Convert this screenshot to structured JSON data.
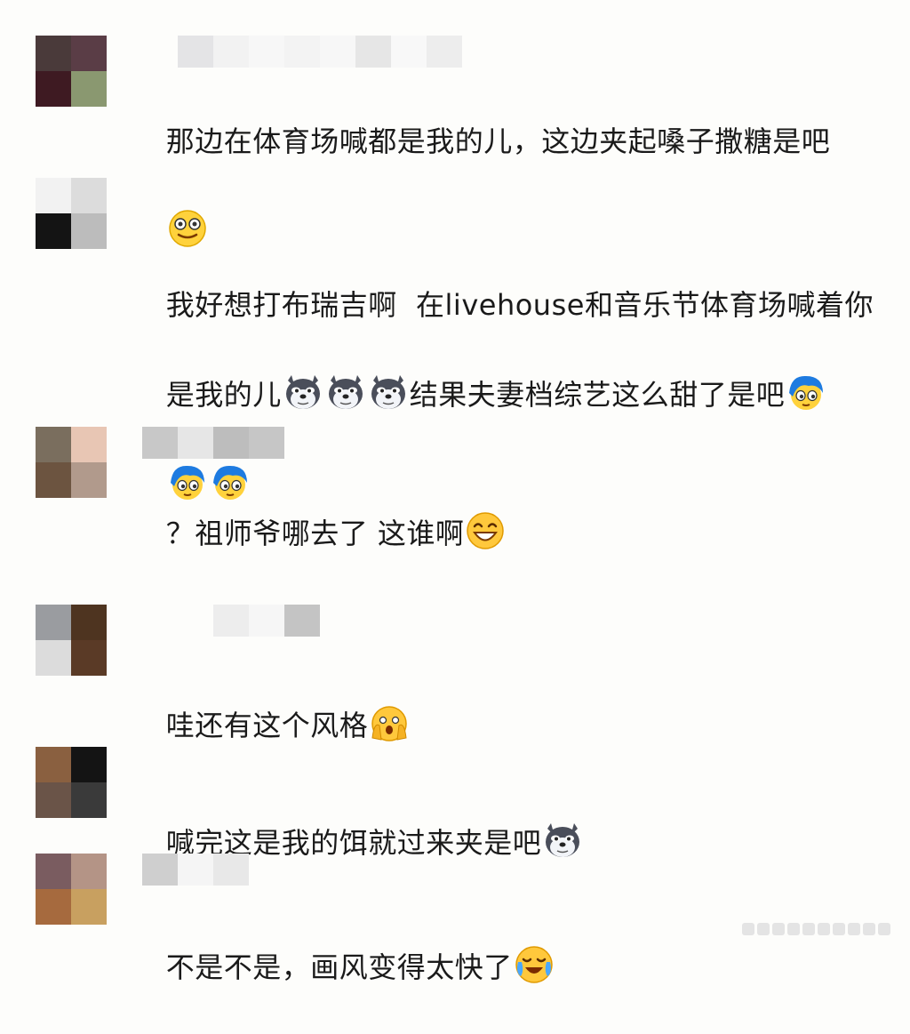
{
  "comments": [
    {
      "text": "那边在体育场喊都是我的儿，这边夹起嗓子撒糖是吧",
      "trailing_emojis": [
        "smiling-face-icon"
      ],
      "avatar_colors": [
        "#4a3a3a",
        "#5a3d46",
        "#3e1a22",
        "#8a9870"
      ]
    },
    {
      "text_line1": "我好想打布瑞吉啊  在livehouse和音乐节体育场喊着你",
      "text_line2_pre": "是我的儿",
      "inline_emojis": [
        "husky-dog-icon",
        "husky-dog-icon",
        "husky-dog-icon"
      ],
      "text_line2_post": "结果夫妻档综艺这么甜了是吧",
      "trailing_emojis": [
        "blue-hair-face-icon",
        "blue-hair-face-icon",
        "blue-hair-face-icon"
      ],
      "avatar_colors": [
        "#f2f2f2",
        "#dcdcdc",
        "#141414",
        "#bcbcbc"
      ]
    },
    {
      "text": "？祖师爷哪去了 这谁啊",
      "trailing_emojis": [
        "grinning-face-icon"
      ],
      "avatar_colors": [
        "#7a6e5e",
        "#e8c6b4",
        "#6c5440",
        "#b19a8c"
      ]
    },
    {
      "text": "哇还有这个风格",
      "trailing_emojis": [
        "face-screaming-icon"
      ],
      "avatar_colors": [
        "#9a9ca0",
        "#4e3420",
        "#dcdcdc",
        "#5a3a26"
      ]
    },
    {
      "text": "喊完这是我的饵就过来夹是吧",
      "trailing_emojis": [
        "husky-dog-icon"
      ],
      "avatar_colors": [
        "#8a6040",
        "#141414",
        "#6a5448",
        "#3a3a3a"
      ]
    },
    {
      "text": "不是不是，画风变得太快了",
      "trailing_emojis": [
        "crying-laughing-icon"
      ],
      "avatar_colors": [
        "#7a5c60",
        "#b49486",
        "#a66a3e",
        "#c8a060"
      ]
    }
  ]
}
